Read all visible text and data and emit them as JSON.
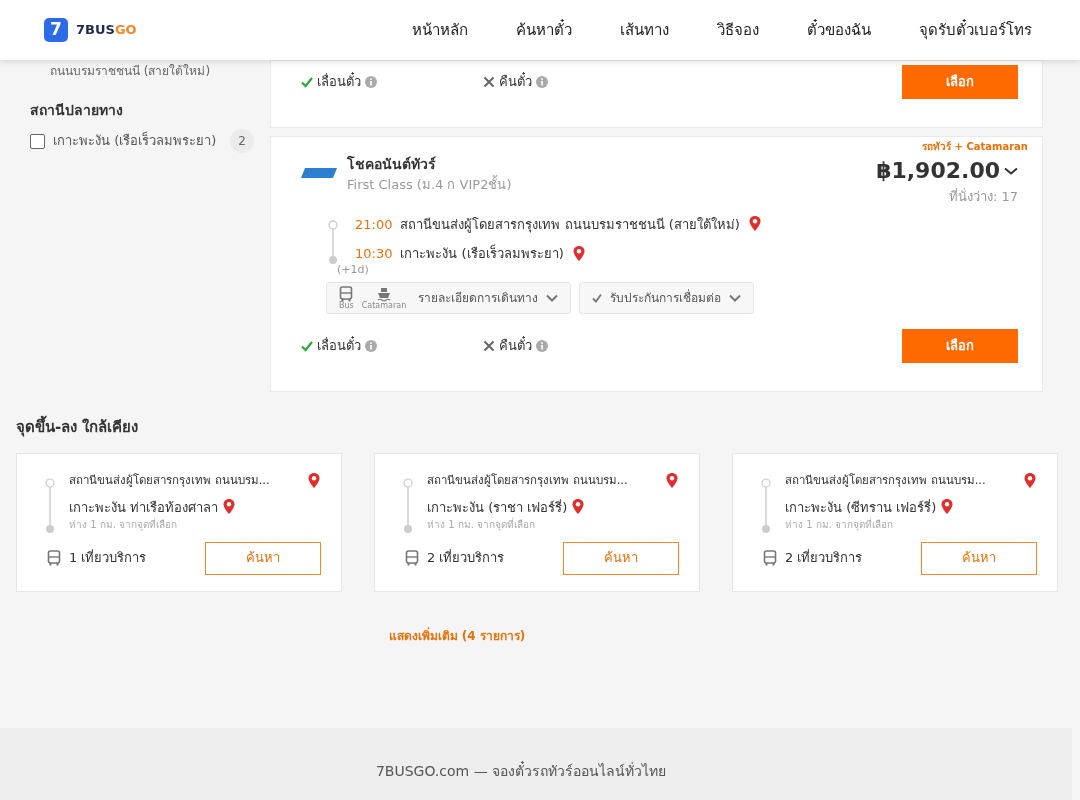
{
  "header": {
    "logo": {
      "mark": "7",
      "text_main": "7BUS",
      "text_accent": "GO"
    },
    "nav": [
      {
        "label": "หน้าหลัก"
      },
      {
        "label": "ค้นหาตั๋ว"
      },
      {
        "label": "เส้นทาง"
      },
      {
        "label": "วิธีจอง"
      },
      {
        "label": "ตั๋วของฉัน"
      },
      {
        "label": "จุดรับตั๋วเบอร์โทร"
      }
    ]
  },
  "sidebar": {
    "cut_text": "ถนนบรมราชชนนี (สายใต้ใหม่)",
    "sections": [
      {
        "title": "สถานีปลายทาง",
        "options": [
          {
            "label": "เกาะพะงัน (เรือเร็วลมพระยา)",
            "count": "2",
            "checked": false
          }
        ]
      }
    ]
  },
  "trips": [
    {
      "kind": "partial",
      "policies": [
        {
          "label": "เลื่อนตั๋ว",
          "allowed": true
        },
        {
          "label": "คืนตั๋ว",
          "allowed": false
        }
      ],
      "select_label": "เลือก"
    },
    {
      "kind": "full",
      "tag": "รถทัวร์ + Catamaran",
      "operator": "โชคอนันต์ทัวร์",
      "class": "First Class (ม.4 ก VIP2ชั้น)",
      "price": "฿1,902.00",
      "seats": "ที่นั่งว่าง: 17",
      "stops": [
        {
          "time": "21:00",
          "name": "สถานีขนส่งผู้โดยสารกรุงเทพ ถนนบรมราชชนนี (สายใต้ใหม่)"
        },
        {
          "time": "10:30",
          "name": "เกาะพะงัน (เรือเร็วลมพระยา)",
          "day_offset": "(+1d)"
        }
      ],
      "modes": [
        {
          "kind": "bus",
          "label": "Bus"
        },
        {
          "kind": "boat",
          "label": "Catamaran"
        }
      ],
      "details_label": "รายละเอียดการเดินทาง",
      "insurance_label": "รับประกันการเชื่อมต่อ",
      "policies": [
        {
          "label": "เลื่อนตั๋ว",
          "allowed": true
        },
        {
          "label": "คืนตั๋ว",
          "allowed": false
        }
      ],
      "select_label": "เลือก"
    }
  ],
  "nearby": {
    "title": "จุดขึ้น-ลง ใกล้เคียง",
    "cards": [
      {
        "from": "สถานีขนส่งผู้โดยสารกรุงเทพ ถนนบรม...",
        "to": "เกาะพะงัน ท่าเรือท้องศาลา",
        "distance": "ห่าง 1 กม. จากจุดที่เลือก",
        "trips": "1 เที่ยวบริการ",
        "button": "ค้นหา"
      },
      {
        "from": "สถานีขนส่งผู้โดยสารกรุงเทพ ถนนบรม...",
        "to": "เกาะพะงัน (ราชา เฟอร์รี่)",
        "distance": "ห่าง 1 กม. จากจุดที่เลือก",
        "trips": "2 เที่ยวบริการ",
        "button": "ค้นหา"
      },
      {
        "from": "สถานีขนส่งผู้โดยสารกรุงเทพ ถนนบรม...",
        "to": "เกาะพะงัน (ซีทราน เฟอร์รี่)",
        "distance": "ห่าง 1 กม. จากจุดที่เลือก",
        "trips": "2 เที่ยวบริการ",
        "button": "ค้นหา"
      }
    ],
    "more": "แสดงเพิ่มเติม (4 รายการ)"
  },
  "footer": {
    "text": "7BUSGO.com — จองตั๋วรถทัวร์ออนไลน์ทั่วไทย"
  }
}
